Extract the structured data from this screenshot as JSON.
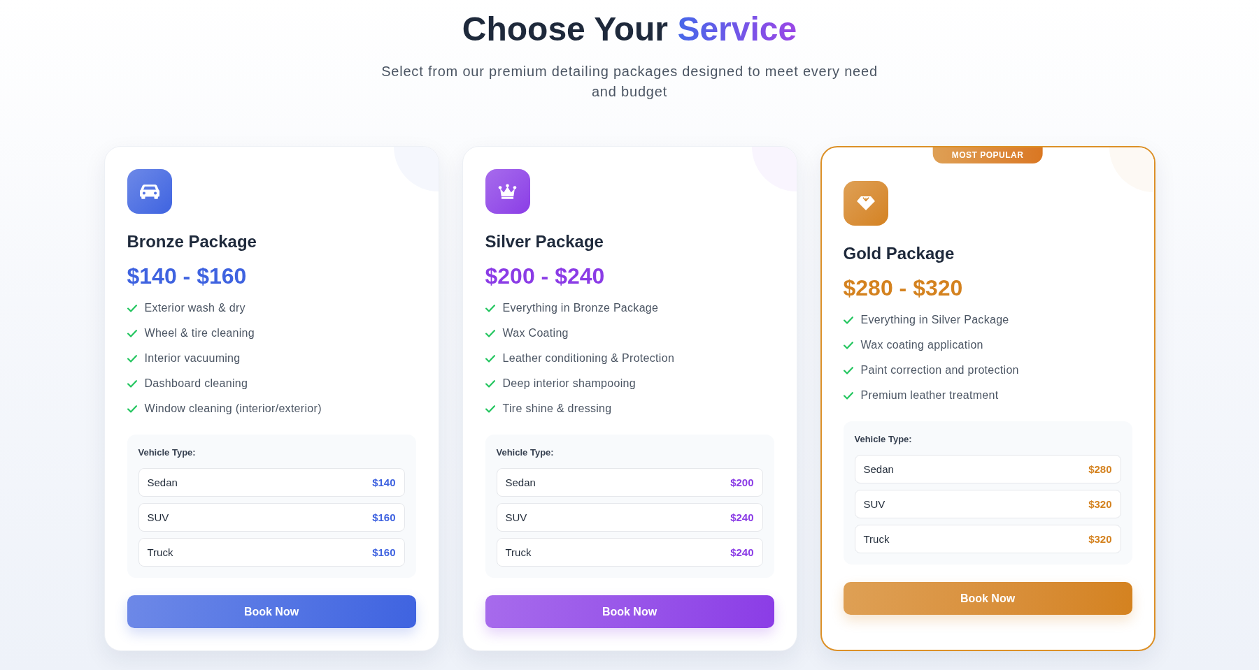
{
  "header": {
    "title": "Choose Your",
    "title_highlight": "Service",
    "subtitle": "Select from our premium detailing packages designed to meet every need and budget"
  },
  "packages": [
    {
      "name": "Bronze Package",
      "price_range": "$140 - $160",
      "color": "#3f63e0",
      "highlighted": false,
      "features": [
        "Exterior wash & dry",
        "Wheel & tire cleaning",
        "Interior vacuuming",
        "Dashboard cleaning",
        "Window cleaning (interior/exterior)"
      ],
      "vehicle_label": "Vehicle Type:",
      "vehicles": [
        {
          "type": "Sedan",
          "price": "$140"
        },
        {
          "type": "SUV",
          "price": "$160"
        },
        {
          "type": "Truck",
          "price": "$160"
        }
      ],
      "button": "Book Now"
    },
    {
      "name": "Silver Package",
      "price_range": "$200 - $240",
      "color": "#8b3ce6",
      "highlighted": false,
      "features": [
        "Everything in Bronze Package",
        "Wax Coating",
        "Leather conditioning & Protection",
        "Deep interior shampooing",
        "Tire shine & dressing"
      ],
      "vehicle_label": "Vehicle Type:",
      "vehicles": [
        {
          "type": "Sedan",
          "price": "$200"
        },
        {
          "type": "SUV",
          "price": "$240"
        },
        {
          "type": "Truck",
          "price": "$240"
        }
      ],
      "button": "Book Now"
    },
    {
      "name": "Gold Package",
      "price_range": "$280 - $320",
      "color": "#d4821f",
      "highlighted": true,
      "badge": "MOST POPULAR",
      "features": [
        "Everything in Silver Package",
        "Wax coating application",
        "Paint correction and protection",
        "Premium leather treatment"
      ],
      "vehicle_label": "Vehicle Type:",
      "vehicles": [
        {
          "type": "Sedan",
          "price": "$280"
        },
        {
          "type": "SUV",
          "price": "$320"
        },
        {
          "type": "Truck",
          "price": "$320"
        }
      ],
      "button": "Book Now"
    }
  ]
}
